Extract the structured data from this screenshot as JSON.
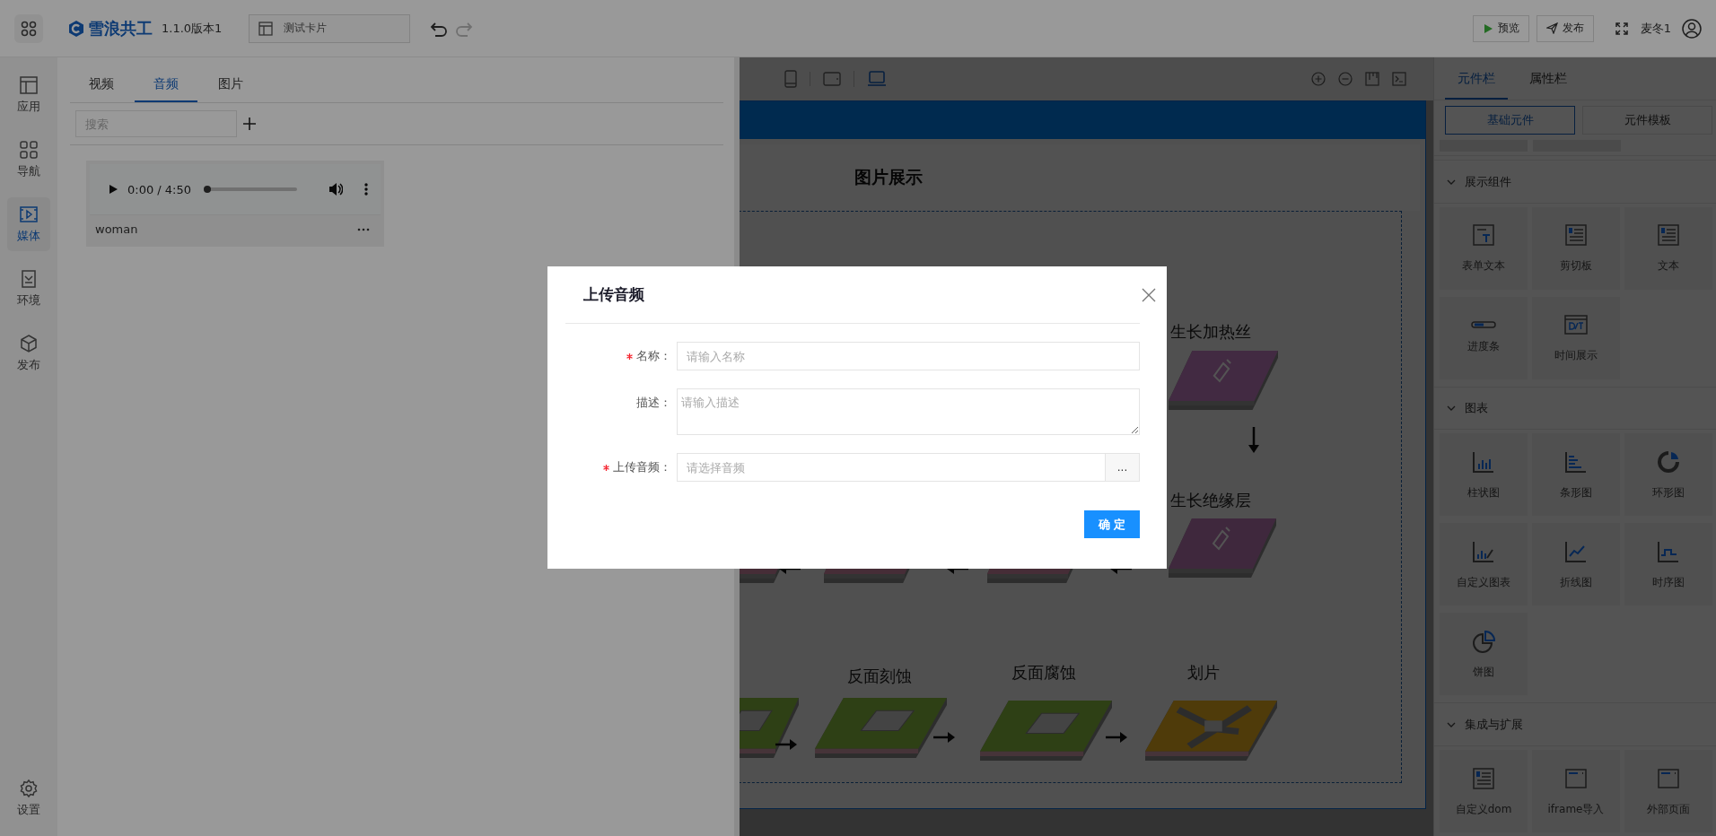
{
  "top_bar": {
    "brand": "雪浪共工",
    "version": "1.1.0版本1",
    "card_select": "测试卡片",
    "buttons": [
      {
        "label": "预览",
        "kind": "preview"
      },
      {
        "label": "发布",
        "kind": "publish"
      }
    ],
    "user": "麦冬1"
  },
  "sidebar": {
    "items": [
      {
        "label": "应用",
        "selected": false
      },
      {
        "label": "导航",
        "selected": false
      },
      {
        "label": "媒体",
        "selected": true
      },
      {
        "label": "环境",
        "selected": false
      },
      {
        "label": "发布",
        "selected": false
      }
    ],
    "footer": {
      "label": "设置"
    }
  },
  "media_panel": {
    "tabs": [
      {
        "label": "视频",
        "selected": false
      },
      {
        "label": "音频",
        "selected": true
      },
      {
        "label": "图片",
        "selected": false
      }
    ],
    "search": {
      "placeholder": "搜索"
    },
    "items": [
      {
        "time": "0:00 / 4:50",
        "level": 0,
        "name": "woman"
      }
    ]
  },
  "canvas": {
    "devices": [
      {
        "kind": "phone",
        "selected": false
      },
      {
        "kind": "tablet",
        "selected": false
      },
      {
        "kind": "desktop",
        "selected": true
      }
    ],
    "page_title": "图片展示",
    "diagram": {
      "steps": [
        {
          "label": "生长加热丝",
          "kind": "heater"
        },
        {
          "label": "生长绝缘层",
          "kind": "insulator"
        },
        {
          "kind": "coated"
        },
        {
          "kind": "coated"
        },
        {
          "kind": "coated"
        },
        {
          "kind": "etched"
        },
        {
          "label": "反面刻蚀",
          "kind": "etched"
        },
        {
          "label": "反面腐蚀",
          "kind": "etched"
        },
        {
          "label": "划片",
          "kind": "diced"
        }
      ]
    }
  },
  "components_panel": {
    "tabs": [
      {
        "label": "元件栏",
        "selected": true
      },
      {
        "label": "属性栏",
        "selected": false
      }
    ],
    "modes": [
      {
        "label": "基础元件",
        "selected": true
      },
      {
        "label": "元件模板",
        "selected": false
      }
    ],
    "sections": [
      {
        "title": "展示组件",
        "expanded": true,
        "items": [
          {
            "label": "表单文本"
          },
          {
            "label": "剪切板"
          },
          {
            "label": "文本"
          },
          {
            "label": "进度条"
          },
          {
            "label": "时间展示"
          }
        ]
      },
      {
        "title": "图表",
        "expanded": true,
        "items": [
          {
            "label": "柱状图"
          },
          {
            "label": "条形图"
          },
          {
            "label": "环形图"
          },
          {
            "label": "自定义图表"
          },
          {
            "label": "折线图"
          },
          {
            "label": "时序图"
          },
          {
            "label": "饼图"
          }
        ]
      },
      {
        "title": "集成与扩展",
        "expanded": true,
        "items": [
          {
            "label": "自定义dom"
          },
          {
            "label": "iframe导入"
          },
          {
            "label": "外部页面"
          }
        ]
      }
    ]
  },
  "dialog": {
    "title": "上传音频",
    "fields": [
      {
        "label": "名称：",
        "required": true,
        "placeholder": "请输入名称",
        "kind": "input"
      },
      {
        "label": "描述：",
        "required": false,
        "placeholder": "请输入描述",
        "kind": "textarea"
      },
      {
        "label": "上传音频：",
        "required": true,
        "placeholder": "请选择音频",
        "kind": "picker",
        "button": "..."
      }
    ],
    "confirm": "确 定"
  }
}
